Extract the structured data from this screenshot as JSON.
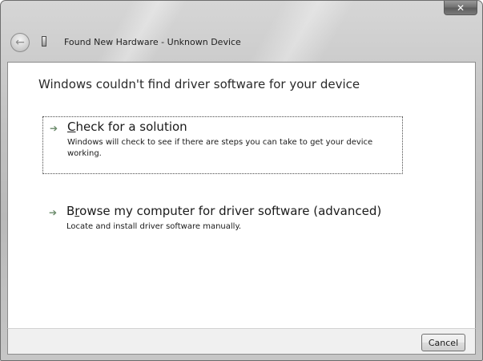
{
  "window": {
    "title": "Found New Hardware - Unknown Device",
    "close_glyph": "✕"
  },
  "content": {
    "heading": "Windows couldn't find driver software for your device",
    "options": [
      {
        "title_accel": "C",
        "title_rest": "heck for a solution",
        "description": "Windows will check to see if there are steps you can take to get your device working."
      },
      {
        "title_first": "B",
        "title_accel": "r",
        "title_rest": "owse my computer for driver software (advanced)",
        "description": "Locate and install driver software manually."
      }
    ]
  },
  "footer": {
    "cancel_label": "Cancel"
  },
  "icons": {
    "back": "back-arrow-icon",
    "device": "usb-device-icon",
    "option_arrow": "green-arrow-icon",
    "close": "close-icon"
  }
}
